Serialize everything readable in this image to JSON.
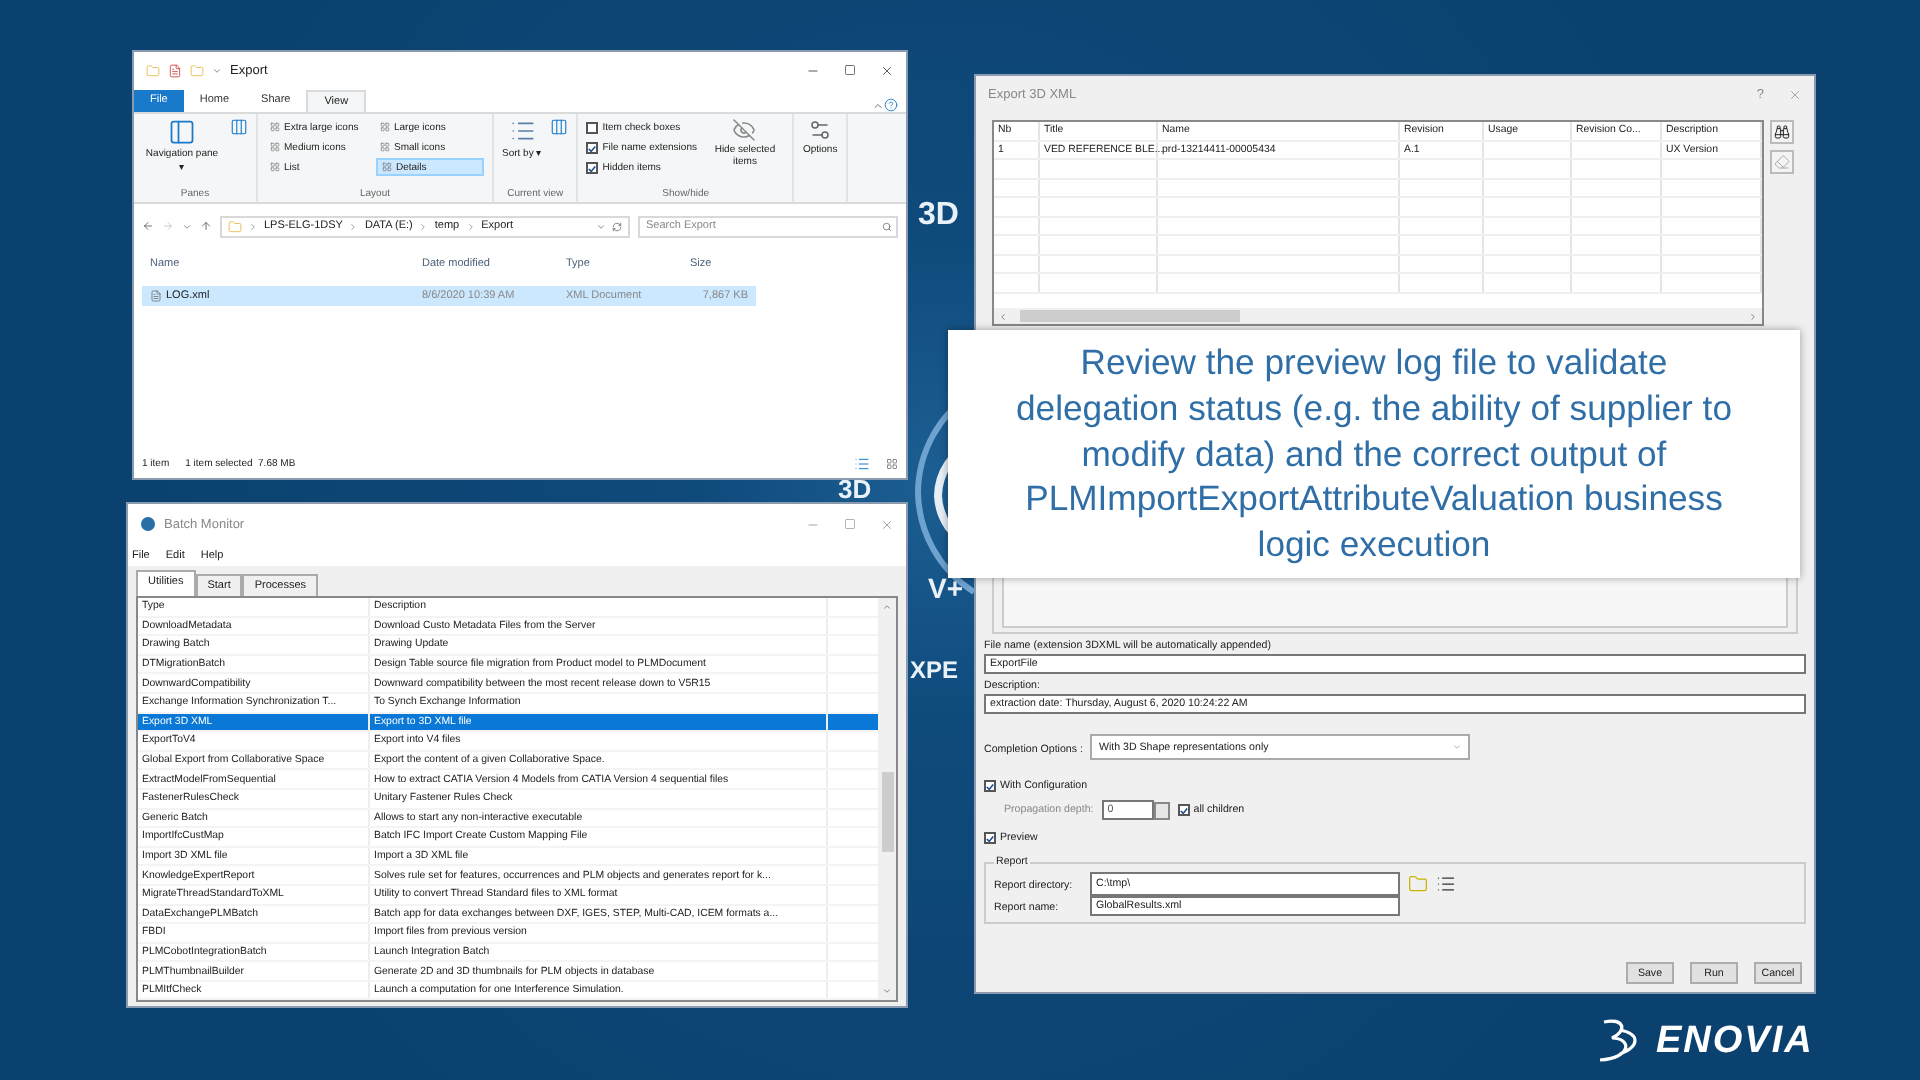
{
  "background": {
    "marks": [
      "3D",
      "3D",
      "V+",
      "XPE"
    ],
    "brand": "ENOVIA"
  },
  "explorer": {
    "title": "Export",
    "ribbon_tabs": [
      {
        "label": "File",
        "kind": "file",
        "selected": false
      },
      {
        "label": "Home",
        "kind": "tab",
        "selected": false
      },
      {
        "label": "Share",
        "kind": "tab",
        "selected": false
      },
      {
        "label": "View",
        "kind": "tab",
        "selected": true
      }
    ],
    "panes": {
      "button": "Navigation pane ▾",
      "group": "Panes"
    },
    "layout": {
      "options": [
        {
          "label": "Extra large icons",
          "selected": false
        },
        {
          "label": "Large icons",
          "selected": false
        },
        {
          "label": "Medium icons",
          "selected": false
        },
        {
          "label": "Small icons",
          "selected": false
        },
        {
          "label": "List",
          "selected": false
        },
        {
          "label": "Details",
          "selected": true
        }
      ],
      "group": "Layout"
    },
    "current_view": {
      "button": "Sort by ▾",
      "group": "Current view"
    },
    "show_hide": {
      "checkboxes": [
        {
          "label": "Item check boxes",
          "checked": false
        },
        {
          "label": "File name extensions",
          "checked": true
        },
        {
          "label": "Hidden items",
          "checked": true
        }
      ],
      "button": "Hide selected items",
      "group": "Show/hide"
    },
    "options": "Options",
    "breadcrumb": [
      "LPS-ELG-1DSY",
      "DATA (E:)",
      "temp",
      "Export"
    ],
    "search": {
      "placeholder": "Search Export"
    },
    "columns": [
      "Name",
      "Date modified",
      "Type",
      "Size"
    ],
    "rows": [
      {
        "name": "LOG.xml",
        "date": "8/6/2020 10:39 AM",
        "type": "XML Document",
        "size": "7,867 KB",
        "selected": true
      }
    ],
    "status": [
      "1 item",
      "1 item selected  7.68 MB"
    ]
  },
  "batch_monitor": {
    "title": "Batch Monitor",
    "menu": [
      "File",
      "Edit",
      "Help"
    ],
    "tabs": [
      {
        "label": "Utilities",
        "selected": true
      },
      {
        "label": "Start",
        "selected": false
      },
      {
        "label": "Processes",
        "selected": false
      }
    ],
    "columns": [
      "Type",
      "Description"
    ],
    "rows": [
      {
        "type": "DownloadMetadata",
        "description": "Download Custo Metadata Files from the Server",
        "selected": false
      },
      {
        "type": "Drawing Batch",
        "description": "Drawing Update",
        "selected": false
      },
      {
        "type": "DTMigrationBatch",
        "description": "Design Table source file migration from Product model to PLMDocument",
        "selected": false
      },
      {
        "type": "DownwardCompatibility",
        "description": "Downward compatibility between the most recent release down to V5R15",
        "selected": false
      },
      {
        "type": "Exchange Information Synchronization T...",
        "description": "To Synch Exchange Information",
        "selected": false
      },
      {
        "type": "Export 3D XML",
        "description": "Export to 3D XML file",
        "selected": true
      },
      {
        "type": "ExportToV4",
        "description": "Export into V4 files",
        "selected": false
      },
      {
        "type": "Global Export from Collaborative Space",
        "description": "Export the content of a given Collaborative Space.",
        "selected": false
      },
      {
        "type": "ExtractModelFromSequential",
        "description": "How to extract CATIA Version 4 Models from CATIA Version 4 sequential files",
        "selected": false
      },
      {
        "type": "FastenerRulesCheck",
        "description": "Unitary Fastener Rules Check",
        "selected": false
      },
      {
        "type": "Generic Batch",
        "description": "Allows to start any non-interactive executable",
        "selected": false
      },
      {
        "type": "ImportIfcCustMap",
        "description": "Batch IFC Import Create Custom Mapping File",
        "selected": false
      },
      {
        "type": "Import 3D XML file",
        "description": "Import a 3D XML file",
        "selected": false
      },
      {
        "type": "KnowledgeExpertReport",
        "description": "Solves rule set for features, occurrences and PLM objects and generates report for k...",
        "selected": false
      },
      {
        "type": "MigrateThreadStandardToXML",
        "description": "Utility to convert Thread Standard files to XML format",
        "selected": false
      },
      {
        "type": "DataExchangePLMBatch",
        "description": "Batch app for data exchanges between DXF, IGES, STEP, Multi-CAD, ICEM formats a...",
        "selected": false
      },
      {
        "type": "FBDI",
        "description": "Import files from previous version",
        "selected": false
      },
      {
        "type": "PLMCobotIntegrationBatch",
        "description": "Launch Integration Batch",
        "selected": false
      },
      {
        "type": "PLMThumbnailBuilder",
        "description": "Generate 2D and 3D thumbnails for PLM objects in database",
        "selected": false
      },
      {
        "type": "PLMItfCheck",
        "description": "Launch a computation for one Interference Simulation.",
        "selected": false
      }
    ]
  },
  "export_dialog": {
    "title": "Export 3D XML",
    "help": "?",
    "columns": [
      "Nb",
      "Title",
      "Name",
      "Revision",
      "Usage",
      "Revision Co...",
      "Description"
    ],
    "rows": [
      {
        "nb": "1",
        "title": "VED REFERENCE BLE...",
        "name": "prd-13214411-00005434",
        "revision": "A.1",
        "description": "UX Version"
      }
    ],
    "file_name": {
      "label": "File name (extension 3DXML will be automatically appended)",
      "value": "ExportFile"
    },
    "description": {
      "label": "Description:",
      "value": "extraction date: Thursday, August 6, 2020 10:24:22 AM"
    },
    "completion": {
      "label": "Completion Options :",
      "value": "With 3D Shape representations only"
    },
    "with_configuration": {
      "label": "With Configuration",
      "checked": true
    },
    "propagation": {
      "label": "Propagation depth:",
      "value": "0",
      "disabled": true
    },
    "all_children": {
      "label": "all children",
      "checked": true
    },
    "preview": {
      "label": "Preview",
      "checked": true
    },
    "report": {
      "group": "Report",
      "directory_label": "Report directory:",
      "directory": "C:\\tmp\\",
      "name_label": "Report name:",
      "name": "GlobalResults.xml"
    },
    "buttons": [
      "Save",
      "Run",
      "Cancel"
    ]
  },
  "callout": "Review the preview log file to validate delegation status (e.g. the ability of supplier to modify data) and the correct output of PLMImportExportAttributeValuation business logic execution"
}
